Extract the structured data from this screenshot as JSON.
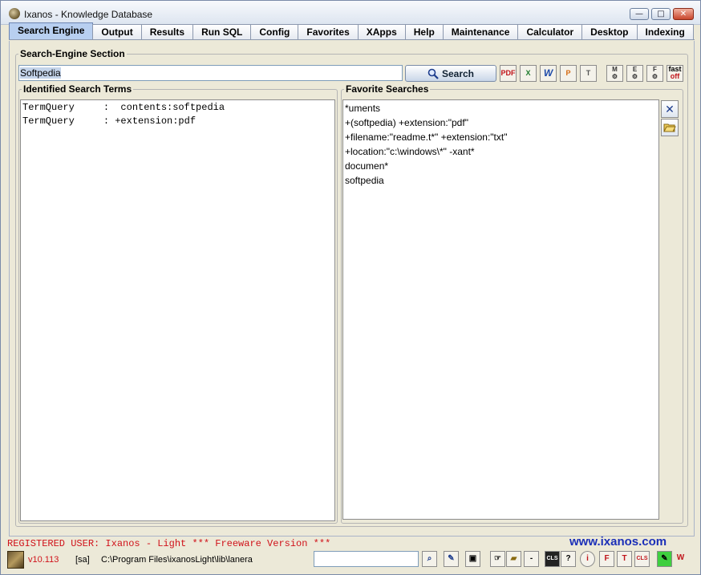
{
  "window": {
    "title": "Ixanos - Knowledge Database",
    "minimize": "—",
    "maximize": "□",
    "close": "✕"
  },
  "tabs": [
    {
      "label": "Search Engine",
      "active": true
    },
    {
      "label": "Output"
    },
    {
      "label": "Results"
    },
    {
      "label": "Run SQL"
    },
    {
      "label": "Config"
    },
    {
      "label": "Favorites"
    },
    {
      "label": "XApps"
    },
    {
      "label": "Help"
    },
    {
      "label": "Maintenance"
    },
    {
      "label": "Calculator"
    },
    {
      "label": "Desktop"
    },
    {
      "label": "Indexing"
    }
  ],
  "search_section": {
    "legend": "Search-Engine Section",
    "query": "Softpedia",
    "search_button": "Search",
    "toolbar": {
      "pdf": "PDF",
      "xls": "X",
      "doc": "W",
      "ppt": "P",
      "txt": "T",
      "m": "M",
      "e": "E",
      "f": "F",
      "fast_top": "fast",
      "fast_bottom": "off"
    }
  },
  "identified_terms": {
    "legend": "Identified Search Terms",
    "lines": [
      "TermQuery     :  contents:softpedia",
      "TermQuery     : +extension:pdf"
    ]
  },
  "favorite_searches": {
    "legend": "Favorite Searches",
    "items": [
      "*uments",
      "+(softpedia) +extension:\"pdf\"",
      "+filename:\"readme.t*\" +extension:\"txt\"",
      "+location:\"c:\\windows\\*\" -xant*",
      "documen*",
      "softpedia"
    ]
  },
  "footer": {
    "registered": "REGISTERED USER: Ixanos - Light *** Freeware Version ***",
    "website": "www.ixanos.com",
    "version": "v10.113",
    "user": "[sa]",
    "path": "C:\\Program Files\\ixanosLight\\lib\\lanera",
    "cls": "CLS",
    "help": "?",
    "info": "i",
    "minus": "-",
    "f": "F",
    "t": "T",
    "cls2": "CLS",
    "w": "W"
  },
  "colors": {
    "active_tab": "#b8cff0",
    "registered_text": "#d0121a",
    "website_link": "#1b2fb8"
  }
}
